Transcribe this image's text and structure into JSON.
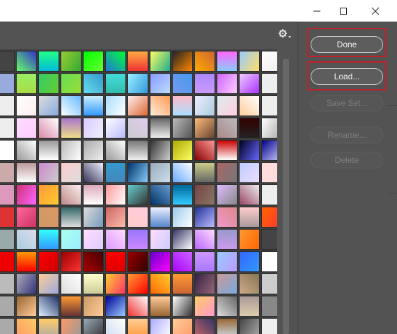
{
  "window": {
    "controls": [
      "minimize-icon",
      "maximize-icon",
      "close-icon"
    ],
    "background": "#535353"
  },
  "panel": {
    "menu_icon": "gear-icon"
  },
  "buttons": {
    "done": "Done",
    "load": "Load...",
    "save_set": "Save Set...",
    "rename": "Rename...",
    "delete": "Delete"
  },
  "highlight_color": "#c0202a",
  "swatches": [
    [
      "#444",
      "#6f6;#33c",
      "#2f8;#0bd",
      "#9c3;#3a3",
      "#0f0;#6f3",
      "#27d;#0f3",
      "#fa4;#e33",
      "#ff6;#2a8",
      "#222;#f80",
      "#fa0;#c63",
      "#f6f;#8cf",
      "#9cf;#fd6",
      "#fff;#eee"
    ],
    [
      "#9ad",
      "#9e6;#ad4",
      "#3c6;#6c3",
      "#6d5;#9d3",
      "#6de;#39c",
      "#4dd;#3ba",
      "#9ef;#39d",
      "#89f;#bdf",
      "#79e;#49e",
      "#a8f;#c9f",
      "#c6f;#fcf",
      "#ecf;#a3f",
      "#eee"
    ],
    [
      "#eee",
      "#fff;#fee",
      "#ddd;#8ad",
      "#fff;#6bf",
      "#cef;#39f",
      "#adf;#fff",
      "#fee;#d63",
      "#fed;#f95",
      "#fbc;#adf",
      "#eef;#acd",
      "#dee;#fcd",
      "#fc9;#fff",
      "#eee"
    ],
    [
      "#eee",
      "#fdf;#fcf",
      "#d8a;#fff",
      "#a7c;#ed8",
      "#dcf;#eef",
      "#fff;#bbf",
      "#ccc;#dce",
      "#666;#eee",
      "#bbb;#555",
      "#fb7;#643",
      "#a88;#bbb",
      "#300;#222",
      "#fff;#aaa"
    ],
    [
      "#fff",
      "#999;#fff",
      "#999;#fff",
      "#bbb;#fff",
      "#aaa;#eee",
      "#999;#fff",
      "#777;#eee",
      "#333;#ccc",
      "#aa0;#ff6",
      "#800;#f99",
      "#c00;#fff",
      "#002;#66f",
      "#008;#ccf"
    ],
    [
      "#caa",
      "#b99;#fff",
      "#c8c;#ccc",
      "#fcc;#ddd",
      "#335;#eef",
      "#39c;#48b",
      "#036;#8cf",
      "#9ab;#cde",
      "#6af;#fff",
      "#cc8;#666",
      "#a66;#777",
      "#bcf;#edf",
      "#fdd"
    ],
    [
      "#d9b",
      "#c37;#f6f",
      "#f93;#fc3",
      "#b88;#fee",
      "#dab;#fff",
      "#f99;#fff",
      "#6cc;#333",
      "#036;#69c",
      "#069;#3cf",
      "#744;#876",
      "#dbf;#888",
      "#946;#eee",
      "#eee"
    ],
    [
      "#d33",
      "#f69;#c36",
      "#c96;#d96",
      "#366;#ddd",
      "#ddd;#79b",
      "#c66;#fba",
      "#fcc;#fcd",
      "#eef;#58c",
      "#9ce;#fff",
      "#239;#bbf",
      "#e9c;#d88",
      "#fcc;#a99",
      "#f60;#f33"
    ],
    [
      "#9aa",
      "#acd;#dde",
      "#3ff;#39f",
      "#afe;#9ef",
      "#fdf;#dcf",
      "#d9f;#fdf",
      "#97f;#c8f",
      "#fdf;#ccf",
      "#336;#fff",
      "#b6f;#fdf",
      "#99c;#c9e",
      "#f93;#f60",
      "#444"
    ],
    [
      "#e00",
      "#f90;#f00",
      "#f00;#c00",
      "#900;#f33",
      "#a00;#400",
      "#f00;#d00",
      "#900;#300",
      "#60c;#f0f",
      "#a0f;#c6f",
      "#c9f;#a7f",
      "#9cf;#b9f",
      "#36f;#39f",
      "#fff"
    ],
    [
      "#bbb",
      "#aab;#337",
      "#fc9;#9ad",
      "#ddd;#fff",
      "#ffc;#cc9",
      "#fc3;#f36",
      "#f93;#f00",
      "#f60;#fc3",
      "#f93;#c63",
      "#324;#967",
      "#c99;#7ad",
      "#ca8;#875",
      "#ccc"
    ],
    [
      "#aaa",
      "#963;#fc9",
      "#def;#236",
      "#f93;#633",
      "#c96;#fc9",
      "#009;#9cf",
      "#e33;#fff",
      "#fc9;#963",
      "#fff;#333",
      "#fc6;#f9c",
      "#ddd;#666",
      "#a99;#dca",
      "#888"
    ],
    [
      "#aaa",
      "#f96;#fc6",
      "#fc6;#aaa",
      "#f96;#999",
      "#9ab;#333",
      "#cde;#fff",
      "#fc9;#f93",
      "#aaf;#fff",
      "#fc9;#f96",
      "#c66;#336",
      "#963;#cde",
      "#444;#aaa",
      "#eee"
    ]
  ]
}
